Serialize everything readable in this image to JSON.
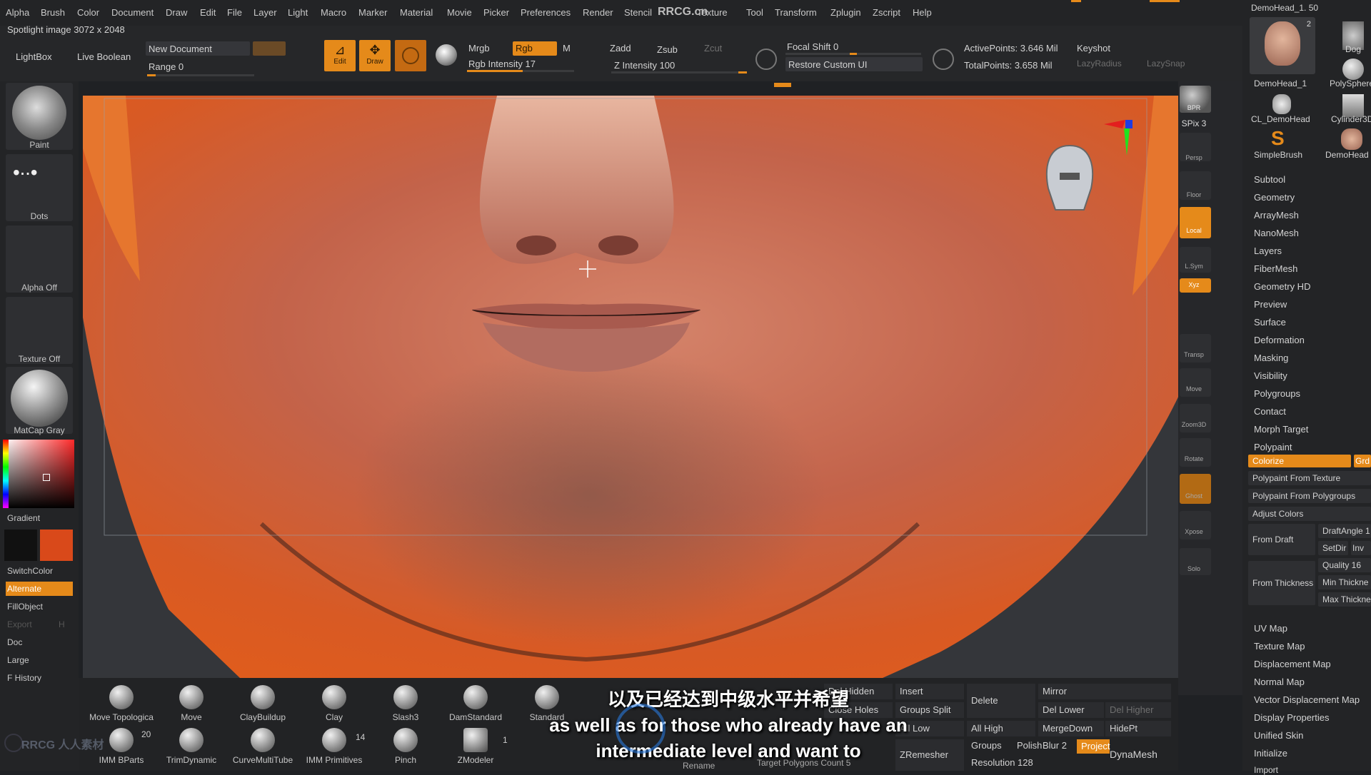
{
  "menu": [
    "Alpha",
    "Brush",
    "Color",
    "Document",
    "Draw",
    "Edit",
    "File",
    "Layer",
    "Light",
    "Macro",
    "Marker",
    "Material",
    "Movie",
    "Picker",
    "Preferences",
    "Render",
    "Stencil",
    "RRCG.cn",
    "Texture",
    "Tool",
    "Transform",
    "Zplugin",
    "Zscript",
    "Help"
  ],
  "spotlight_info": "Spotlight image 3072 x 2048",
  "toolbar": {
    "lightbox": "LightBox",
    "live_boolean": "Live Boolean",
    "new_document": "New Document",
    "range": "Range 0",
    "edit": "Edit",
    "draw": "Draw",
    "mrgb": "Mrgb",
    "rgb": "Rgb",
    "m": "M",
    "rgb_intensity": "Rgb Intensity 17",
    "zadd": "Zadd",
    "zsub": "Zsub",
    "zcut": "Zcut",
    "z_intensity": "Z Intensity 100",
    "focal_shift": "Focal Shift 0",
    "restore_custom_ui": "Restore Custom UI",
    "active_points": "ActivePoints: 3.646 Mil",
    "total_points": "TotalPoints: 3.658 Mil",
    "keyshot": "Keyshot",
    "lazy_radius": "LazyRadius",
    "lazy_snap": "LazySnap"
  },
  "left_panel": {
    "tiles": [
      "Paint",
      "Dots",
      "Alpha Off",
      "Texture Off",
      "MatCap Gray"
    ],
    "gradient": "Gradient",
    "switch_color": "SwitchColor",
    "alternate": "Alternate",
    "fill_object": "FillObject",
    "export": "Export",
    "h": "H",
    "doc": "Doc",
    "large": "Large",
    "f_history": "F History",
    "primary_color": "#111111",
    "secondary_color": "#d9491a"
  },
  "right_shelf": [
    "BPR",
    "SPix 3",
    "Persp",
    "Floor",
    "Local",
    "L.Sym",
    "Xyz",
    "Transp",
    "Move",
    "Zoom3D",
    "Rotate",
    "Ghost",
    "Xpose",
    "Solo"
  ],
  "tool_thumbs": {
    "current": "DemoHead_1. 50",
    "items": [
      "DemoHead_1",
      "PolySphere",
      "CL_DemoHead",
      "Cylinder3D",
      "SimpleBrush",
      "DemoHead"
    ],
    "count_badge": "2",
    "dog": "Dog"
  },
  "right_panel": {
    "menu": [
      "Subtool",
      "Geometry",
      "ArrayMesh",
      "NanoMesh",
      "Layers",
      "FiberMesh",
      "Geometry HD",
      "Preview",
      "Surface",
      "Deformation",
      "Masking",
      "Visibility",
      "Polygroups",
      "Contact",
      "Morph Target",
      "Polypaint"
    ],
    "colorize": "Colorize",
    "grd": "Grd",
    "polypaint_from_texture": "Polypaint From Texture",
    "polypaint_from_polygroups": "Polypaint From Polygroups",
    "adjust_colors": "Adjust Colors",
    "from_draft": "From Draft",
    "draft_angle": "DraftAngle 1",
    "setdir": "SetDir",
    "inv": "Inv",
    "quality": "Quality 16",
    "from_thickness": "From Thickness",
    "min_thickness": "Min Thickne",
    "max_thickness": "Max Thickne",
    "lower_menu": [
      "UV Map",
      "Texture Map",
      "Displacement Map",
      "Normal Map",
      "Vector Displacement Map",
      "Display Properties",
      "Unified Skin",
      "Initialize",
      "Import"
    ]
  },
  "bottom": {
    "brushes_row1": [
      "Move Topologica",
      "Move",
      "ClayBuildup",
      "Clay",
      "Slash3",
      "DamStandard",
      "Standard"
    ],
    "brushes_row2": [
      "IMM BParts",
      "TrimDynamic",
      "CurveMultiTube",
      "IMM Primitives",
      "Pinch",
      "ZModeler"
    ],
    "badge_20": "20",
    "badge_14": "14",
    "badge_1": "1",
    "buttons": {
      "del_hidden": "Del Hidden",
      "close_holes": "Close Holes",
      "insert": "Insert",
      "groups_split": "Groups Split",
      "all_low": "All Low",
      "delete": "Delete",
      "all_high": "All High",
      "mirror": "Mirror",
      "del_lower": "Del Lower",
      "del_higher": "Del Higher",
      "merge_down": "MergeDown",
      "hide_pt": "HidePt",
      "zremesher": "ZRemesher",
      "groups": "Groups",
      "polish": "Polish",
      "blur": "Blur 2",
      "project": "Project",
      "dynamesh": "DynaMesh",
      "resolution": "Resolution 128",
      "target_polygons": "Target Polygons Count 5",
      "rename": "Rename"
    }
  },
  "subtitles": {
    "zh": "以及已经达到中级水平并希望",
    "en_line1": "as well as for those who already have an",
    "en_line2": "intermediate level and want to"
  },
  "watermark": "RRCG 人人素材"
}
